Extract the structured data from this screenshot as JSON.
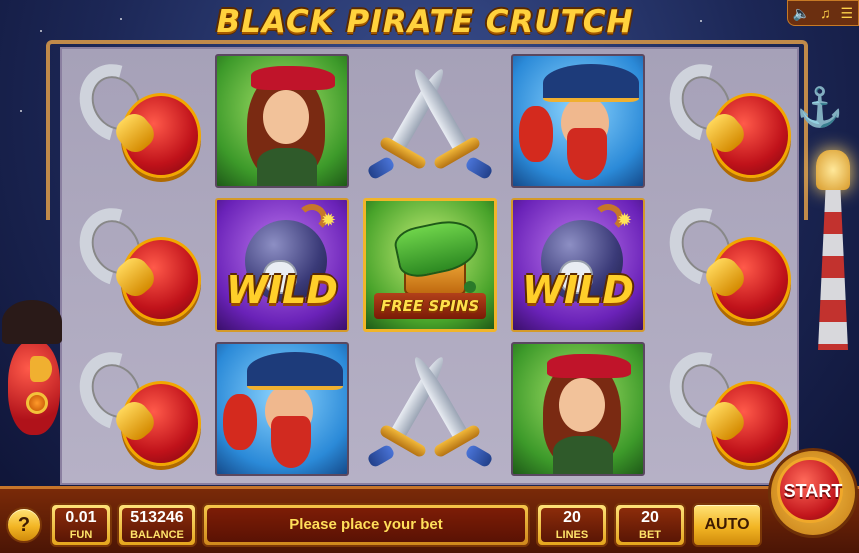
{
  "title": "BLACK PIRATE CRUTCH",
  "top_controls": {
    "sound_icon": "speaker-icon",
    "music_icon": "music-note-icon",
    "menu_icon": "menu-icon"
  },
  "reels": [
    [
      "hook",
      "hook",
      "hook"
    ],
    [
      "pirate-girl",
      "wild",
      "pirate-captain"
    ],
    [
      "swords",
      "free-spins",
      "swords"
    ],
    [
      "pirate-captain",
      "wild",
      "pirate-girl"
    ],
    [
      "hook",
      "hook",
      "hook"
    ]
  ],
  "symbols": {
    "wild_label": "WILD",
    "free_spins_label": "FREE SPINS"
  },
  "bottom_bar": {
    "help_label": "?",
    "coin": {
      "value": "0.01",
      "label": "FUN"
    },
    "balance": {
      "value": "513246",
      "label": "BALANCE"
    },
    "message": "Please place your bet",
    "lines": {
      "value": "20",
      "label": "LINES"
    },
    "bet": {
      "value": "20",
      "label": "BET"
    },
    "auto_label": "AUTO",
    "start_label": "START"
  },
  "colors": {
    "accent_gold": "#f2b524",
    "bar_brown": "#5a1605",
    "text_yellow": "#ffdf5a",
    "start_red": "#c3161c"
  }
}
